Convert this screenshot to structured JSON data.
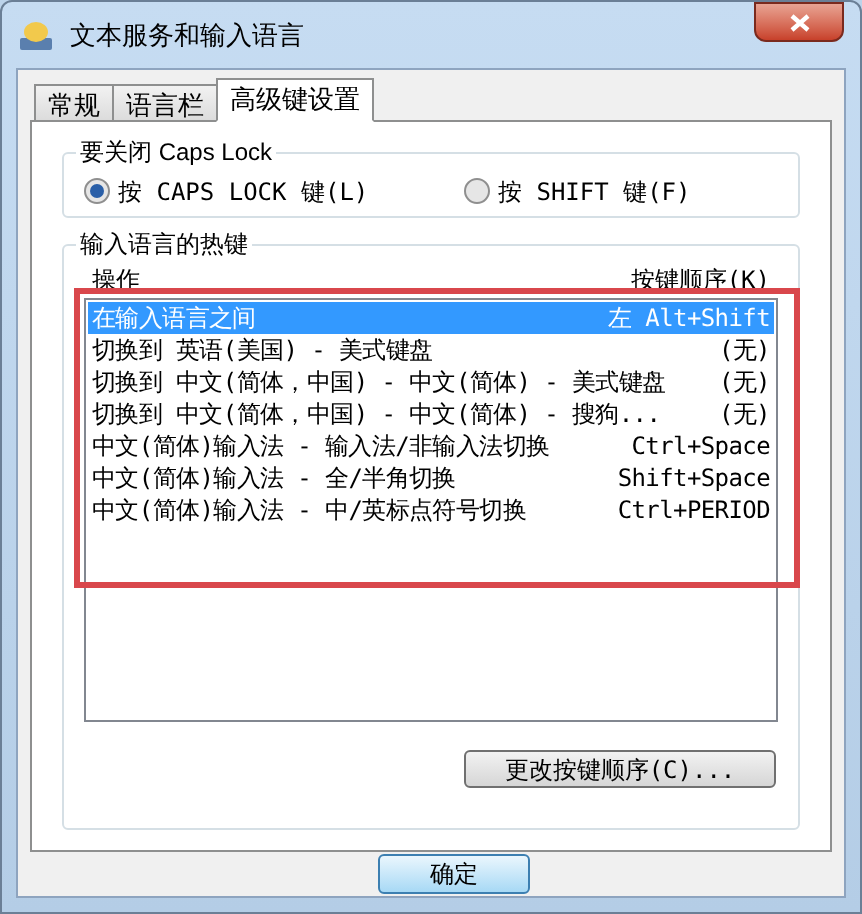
{
  "window": {
    "title": "文本服务和输入语言"
  },
  "tabs": [
    {
      "label": "常规",
      "selected": false
    },
    {
      "label": "语言栏",
      "selected": false
    },
    {
      "label": "高级键设置",
      "selected": true
    }
  ],
  "caps_lock": {
    "title": "要关闭 Caps Lock",
    "options": [
      {
        "label": "按 CAPS LOCK 键(L)",
        "selected": true
      },
      {
        "label": "按 SHIFT 键(F)",
        "selected": false
      }
    ]
  },
  "hotkeys": {
    "title": "输入语言的热键",
    "columns": [
      "操作",
      "按键顺序(K)"
    ],
    "rows": [
      {
        "action": "在输入语言之间",
        "keys": "左 Alt+Shift",
        "selected": true
      },
      {
        "action": "切换到 英语(美国) - 美式键盘",
        "keys": "(无)",
        "selected": false
      },
      {
        "action": "切换到 中文(简体，中国) - 中文(简体) - 美式键盘",
        "keys": "(无)",
        "selected": false
      },
      {
        "action": "切换到 中文(简体，中国) - 中文(简体) - 搜狗...",
        "keys": "(无)",
        "selected": false
      },
      {
        "action": "中文(简体)输入法 - 输入法/非输入法切换",
        "keys": "Ctrl+Space",
        "selected": false
      },
      {
        "action": "中文(简体)输入法 - 全/半角切换",
        "keys": "Shift+Space",
        "selected": false
      },
      {
        "action": "中文(简体)输入法 - 中/英标点符号切换",
        "keys": "Ctrl+PERIOD",
        "selected": false
      }
    ],
    "change_button": "更改按键顺序(C)..."
  },
  "ok_button": "确定"
}
